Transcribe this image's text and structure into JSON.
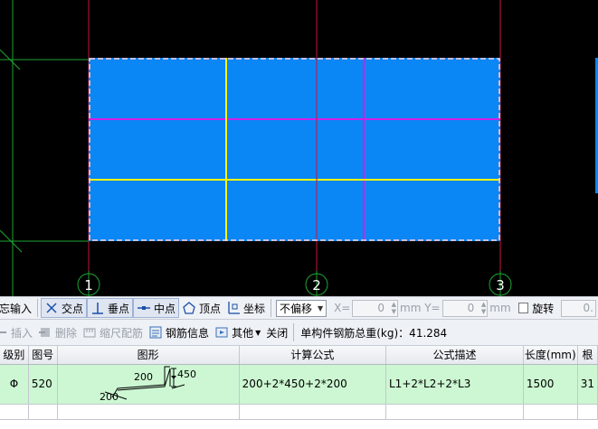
{
  "canvas": {
    "axis_labels": [
      "1",
      "2",
      "3"
    ]
  },
  "snap_toolbar": {
    "input_label": "忘输入",
    "items": [
      {
        "label": "交点"
      },
      {
        "label": "垂点"
      },
      {
        "label": "中点"
      },
      {
        "label": "顶点"
      },
      {
        "label": "坐标"
      }
    ],
    "offset_select": "不偏移",
    "x_label": "X=",
    "x_value": "0",
    "y_label": "mm Y=",
    "y_value": "0",
    "unit": "mm",
    "rotate_label": "旋转",
    "rotate_value": "0."
  },
  "rebar_toolbar": {
    "insert": "插入",
    "delete": "删除",
    "ruler": "缩尺配筋",
    "info": "钢筋信息",
    "other": "其他",
    "close": "关闭",
    "total_label": "单构件钢筋总重(kg)：41.284"
  },
  "table": {
    "headers": [
      "级别",
      "图号",
      "图形",
      "计算公式",
      "公式描述",
      "长度(mm)",
      "根"
    ],
    "row": {
      "grade": "Φ",
      "shape_no": "520",
      "shape_dims": [
        "200",
        "450",
        "200"
      ],
      "formula": "200+2*450+2*200",
      "description": "L1+2*L2+2*L3",
      "length": "1500",
      "count": "31"
    }
  },
  "colors": {
    "slab_fill": "#0a86f5",
    "beam_yellow": "#f5f500",
    "beam_magenta": "#d21ee6",
    "grid_red": "#c8143c",
    "grid_green": "#1ea532",
    "selected_row": "#ccf7d2"
  }
}
